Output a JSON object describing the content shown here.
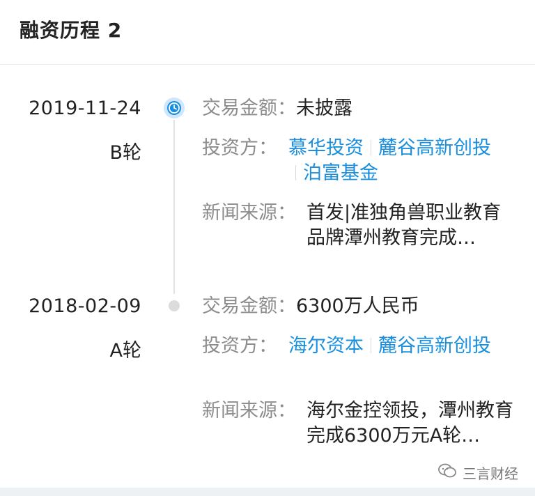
{
  "header": {
    "title": "融资历程 2"
  },
  "rounds": [
    {
      "date": "2019-11-24",
      "stage": "B轮",
      "amount_label": "交易金额：",
      "amount": "未披露",
      "investors_label": "投资方：",
      "investors": [
        "慕华投资",
        "麓谷高新创投",
        "泊富基金"
      ],
      "news_label": "新闻来源：",
      "news": "首发|准独角兽职业教育品牌潭州教育完成…"
    },
    {
      "date": "2018-02-09",
      "stage": "A轮",
      "amount_label": "交易金额：",
      "amount": "6300万人民币",
      "investors_label": "投资方：",
      "investors": [
        "海尔资本",
        "麓谷高新创投"
      ],
      "news_label": "新闻来源：",
      "news": "海尔金控领投，潭州教育完成6300万元A轮…"
    }
  ],
  "watermark": {
    "text": "三言财经",
    "icon": "wechat-icon"
  },
  "colors": {
    "link": "#1a8fde",
    "label": "#8c8c8c",
    "timeline_active": "#1a8fde"
  }
}
